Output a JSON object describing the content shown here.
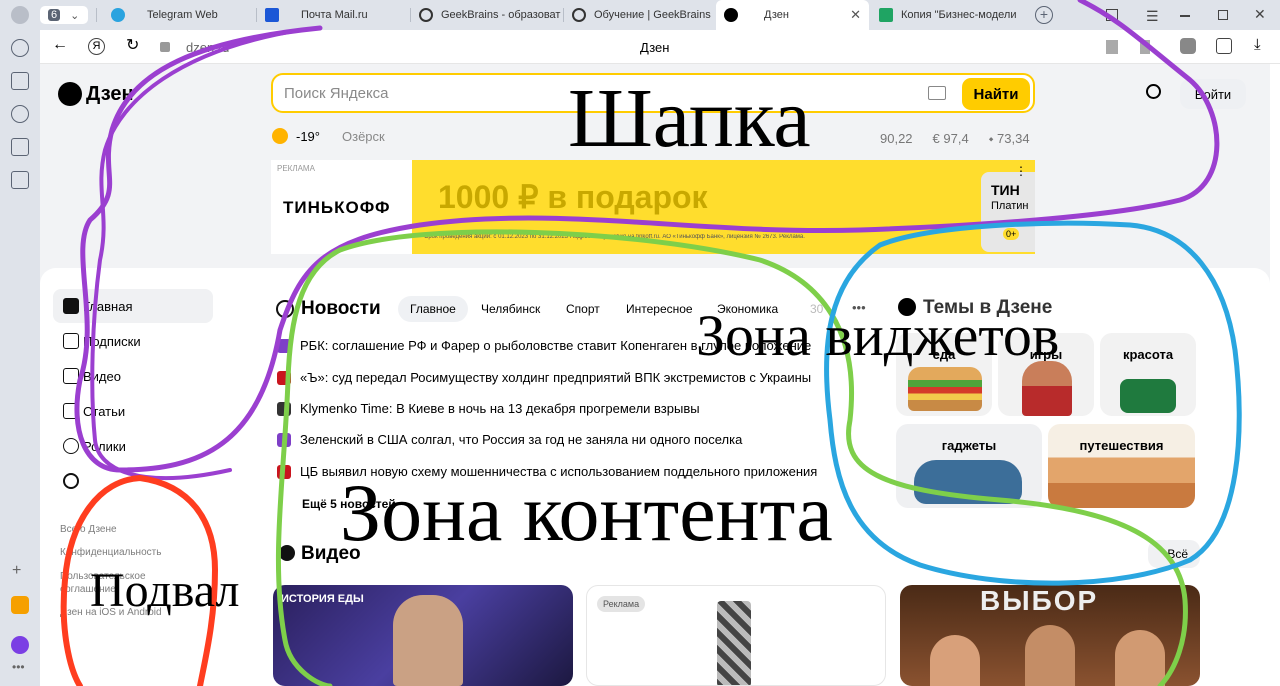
{
  "browser": {
    "tab_count": "6",
    "tabs": [
      {
        "title": "Telegram Web",
        "color": "#2aa3df"
      },
      {
        "title": "Почта Mail.ru",
        "color": "#1b57d6"
      },
      {
        "title": "GeekBrains - образоват",
        "color": "#333333"
      },
      {
        "title": "Обучение | GeekBrains",
        "color": "#333333"
      },
      {
        "title": "Дзен",
        "color": "#000000",
        "active": true
      },
      {
        "title": "Копия \"Бизнес-модели",
        "color": "#1fa463"
      }
    ],
    "address": "dzen.ru",
    "page_title": "Дзен"
  },
  "header": {
    "logo": "Дзен",
    "search_placeholder": "Поиск Яндекса",
    "search_button": "Найти",
    "login_button": "Войти",
    "weather_temp": "-19°",
    "city": "Озёрск",
    "rates": [
      "90,22",
      "€ 97,4",
      "73,34"
    ]
  },
  "ad": {
    "label": "РЕКЛАМА",
    "brand": "ТИНЬКОФФ",
    "headline": "1000 ₽ в подарок",
    "fineprint": "Срок проведения акции: с 01.12.2023 по 31.12.2023 Подробные условия на tinkoff.ru. АО «Тинькофф Банк», лицензия № 2673. Реклама.",
    "card_title": "ТИН",
    "card_sub": "Платин",
    "card_age": "0+"
  },
  "sidebar": {
    "items": [
      {
        "label": "Главная",
        "active": true
      },
      {
        "label": "Подписки"
      },
      {
        "label": "Видео"
      },
      {
        "label": "Статьи"
      },
      {
        "label": "Ролики"
      }
    ],
    "footer": [
      "Все о Дзене",
      "Конфиденциальность",
      "Пользовательское",
      "соглашение",
      "Дзен на iOS и Android"
    ]
  },
  "news": {
    "title": "Новости",
    "tabs": [
      "Главное",
      "Челябинск",
      "Спорт",
      "Интересное",
      "Экономика",
      "30"
    ],
    "items": [
      {
        "text": "РБК: соглашение РФ и Фарер о рыболовстве ставит Копенгаген в глупое положение",
        "color": "#7e3fc7"
      },
      {
        "text": "«Ъ»: суд передал Росимуществу холдинг предприятий ВПК экстремистов с Украины",
        "color": "#c9151e"
      },
      {
        "text": "Klymenko Time: В Киеве в ночь на 13 декабря прогремели взрывы",
        "color": "#333333"
      },
      {
        "text": "Зеленский в США солгал, что Россия за год не заняла ни одного поселка",
        "color": "#7e3fc7"
      },
      {
        "text": "ЦБ выявил новую схему мошенничества с использованием поддельного приложения",
        "color": "#c9151e"
      }
    ],
    "more": "Ещё 5 новостей"
  },
  "topics": {
    "title": "Темы в Дзене",
    "items": [
      "еда",
      "игры",
      "красота",
      "гаджеты",
      "путешествия"
    ]
  },
  "video": {
    "title": "Видео",
    "all": "Всё",
    "cards": [
      {
        "overlay": "ИСТОРИЯ ЕДЫ"
      },
      {
        "badge": "Реклама"
      },
      {
        "overlay": "ВЫБОР"
      }
    ]
  },
  "annotations": {
    "header": "Шапка",
    "widgets": "Зона виджетов",
    "content": "Зона контента",
    "footer": "Подвал"
  }
}
